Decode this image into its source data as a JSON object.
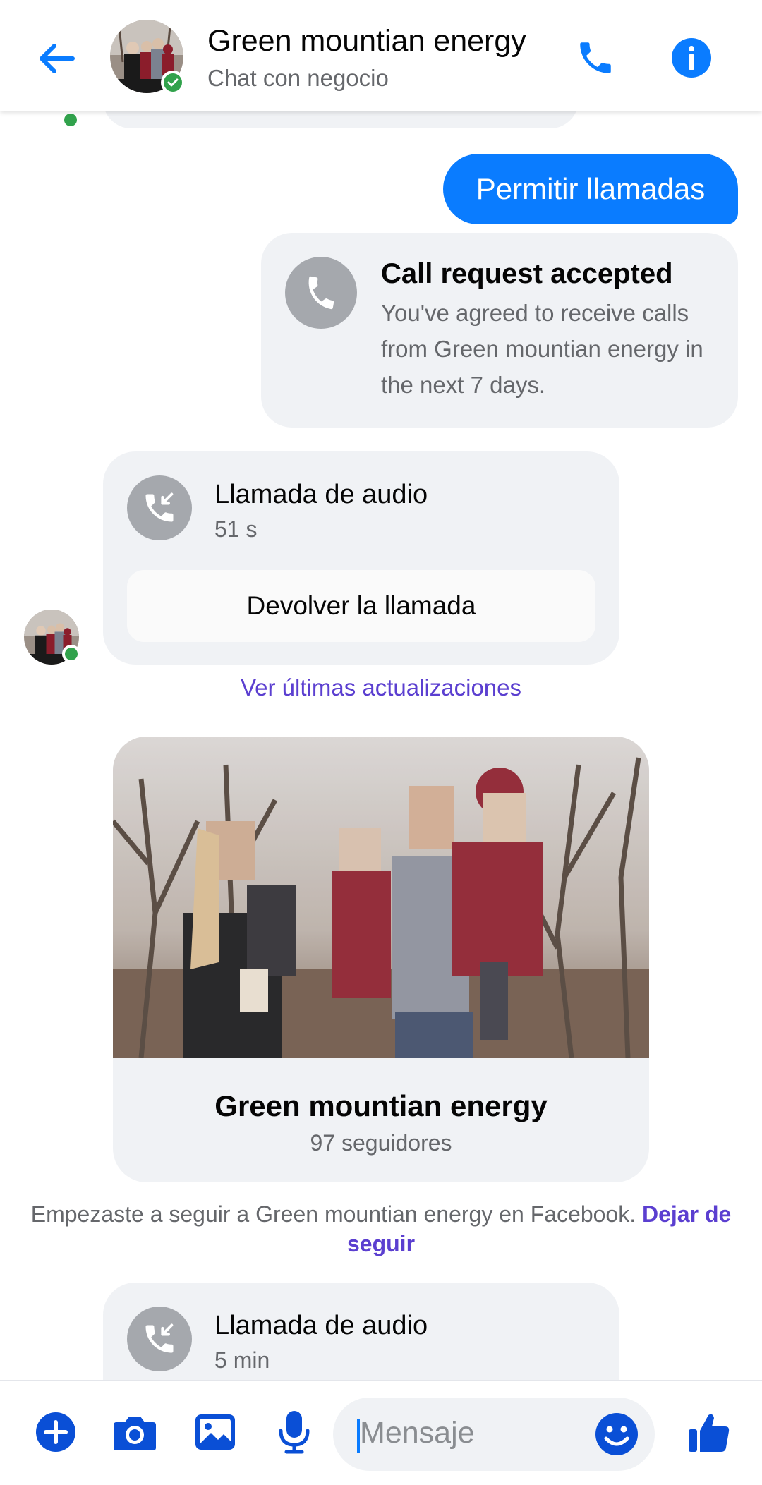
{
  "header": {
    "title": "Green mountian energy",
    "subtitle": "Chat con negocio"
  },
  "messages": {
    "my_message": "Permitir llamadas",
    "accepted": {
      "title": "Call request accepted",
      "body": "You've agreed to receive calls from Green mountian energy in the next 7 days."
    },
    "call1": {
      "title": "Llamada de audio",
      "duration": "51 s",
      "callback": "Devolver la llamada"
    },
    "updates_link": "Ver últimas actualizaciones",
    "profile": {
      "name": "Green mountian energy",
      "followers": "97 seguidores"
    },
    "follow_note": {
      "text": "Empezaste a seguir a Green mountian energy en Facebook. ",
      "unfollow": "Dejar de seguir"
    },
    "call2": {
      "title": "Llamada de audio",
      "duration": "5 min"
    }
  },
  "composer": {
    "placeholder": "Mensaje"
  },
  "colors": {
    "accent": "#0a7cff",
    "link": "#5b3fd0",
    "bubble_grey": "#f0f2f5",
    "online": "#31a24c"
  },
  "icons": [
    "back-arrow-icon",
    "phone-icon",
    "info-icon",
    "plus-icon",
    "camera-icon",
    "gallery-icon",
    "microphone-icon",
    "emoji-icon",
    "thumbs-up-icon",
    "incoming-call-icon"
  ]
}
